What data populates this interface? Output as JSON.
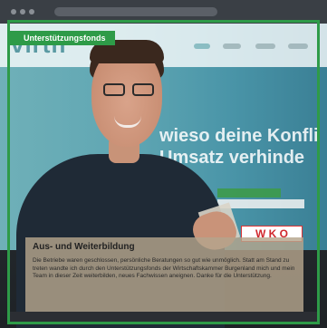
{
  "overlay": {
    "tab_title": "Unterstützungsfonds",
    "caption_title": "Aus- und Weiterbildung",
    "caption_text": "Die Betriebe waren geschlossen, persönliche Beratungen so gut wie unmöglich. Statt am Stand zu treten wandte ich durch den Unterstützungsfonds der Wirtschaftskammer Burgenland mich und mein Team in dieser Zeit weiterbilden, neues Fachwissen aneignen. Danke für die Unterstützung."
  },
  "website": {
    "logo_text": "virth",
    "headline_line1": "wieso deine Konfli",
    "headline_line2": "Umsatz verhinde",
    "badge_logo": "W K O"
  },
  "colors": {
    "frame_green": "#2e9b48",
    "wko_red": "#d0282d"
  }
}
